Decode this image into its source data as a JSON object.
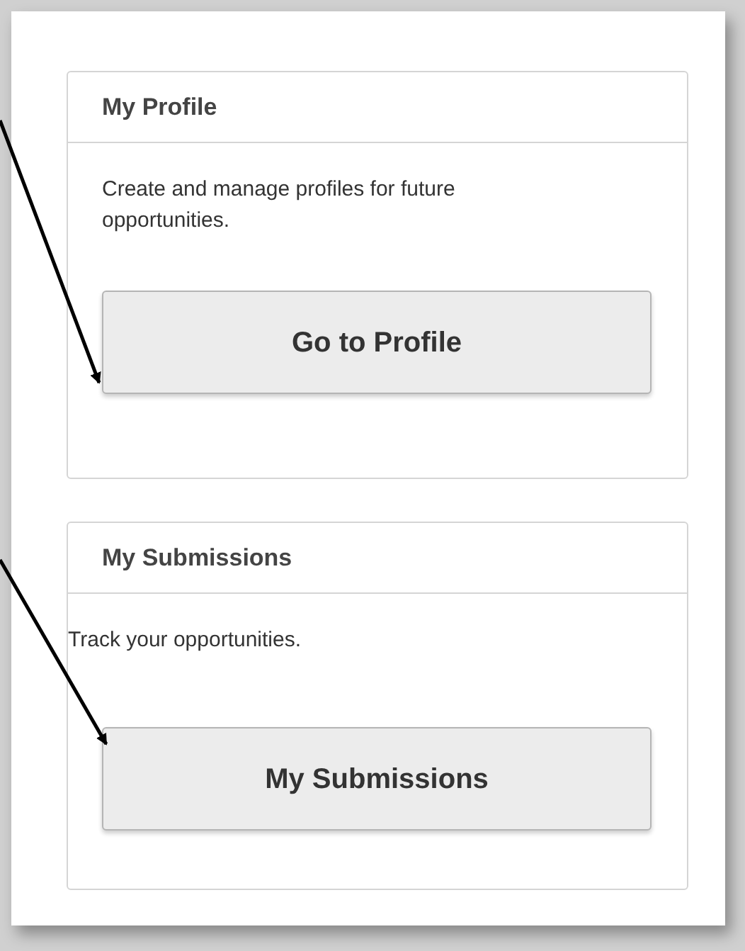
{
  "cards": [
    {
      "title": "My Profile",
      "description": "Create and manage profiles for future opportunities.",
      "button": "Go to Profile"
    },
    {
      "title": "My Submissions",
      "description": "Track your opportunities.",
      "button": "My Submissions"
    }
  ]
}
